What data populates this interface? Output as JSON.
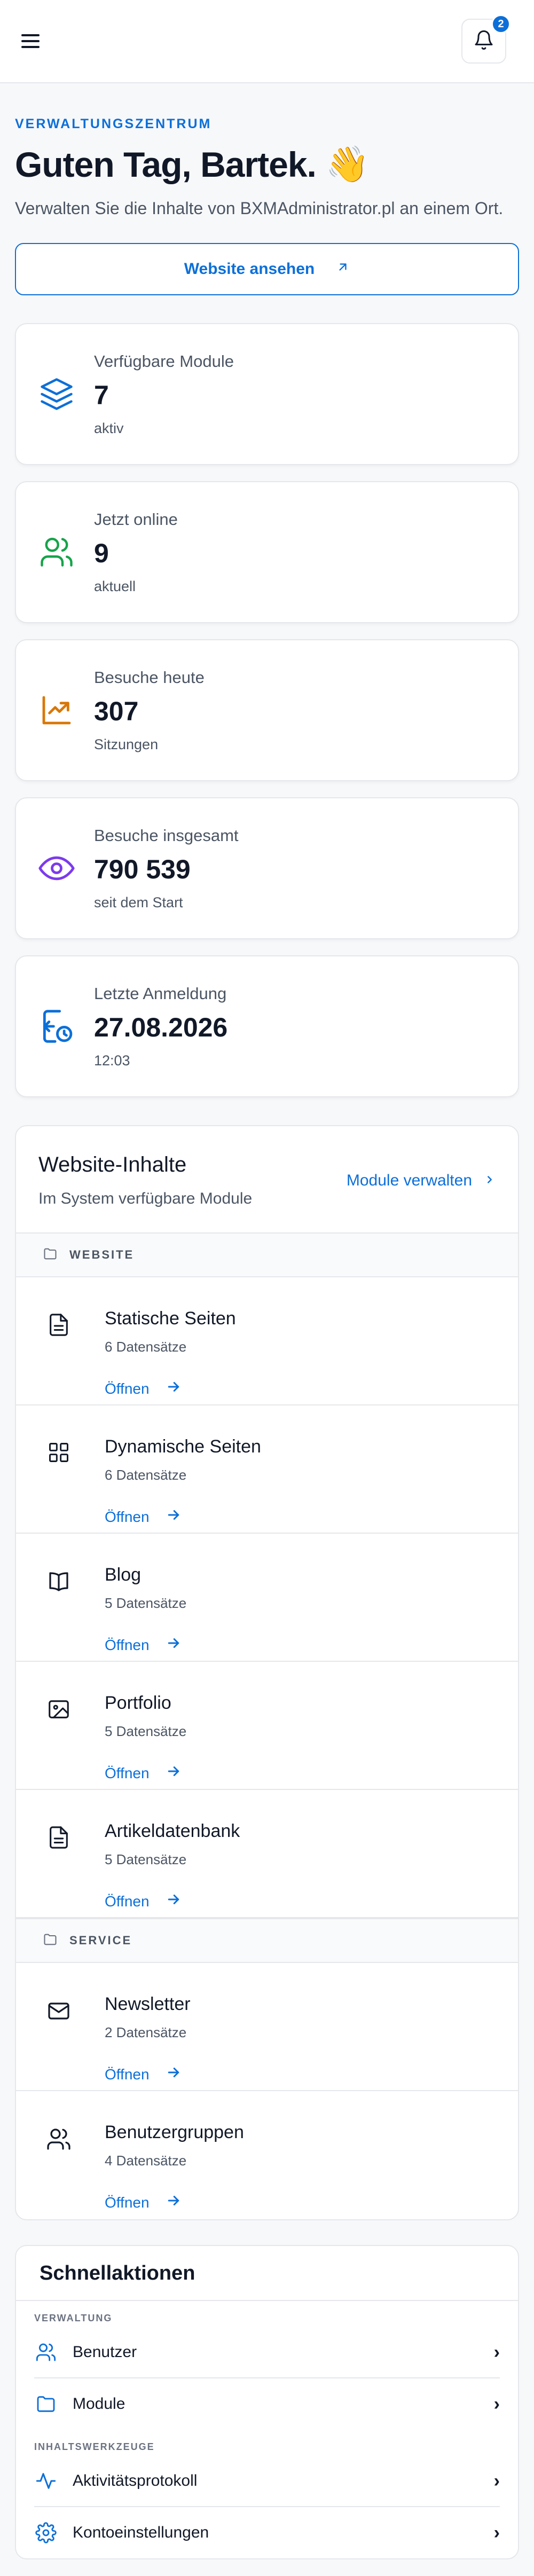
{
  "header": {
    "notifications_count": "2"
  },
  "hero": {
    "eyebrow": "VERWALTUNGSZENTRUM",
    "greeting": "Guten Tag, Bartek.",
    "greeting_emoji": "👋",
    "subtitle": "Verwalten Sie die Inhalte von BXMAdministrator.pl an einem Ort.",
    "view_site_label": "Website ansehen"
  },
  "stats": [
    {
      "label": "Verfügbare Module",
      "value": "7",
      "note": "aktiv",
      "icon": "layers-icon",
      "color": "#0c6fd8"
    },
    {
      "label": "Jetzt online",
      "value": "9",
      "note": "aktuell",
      "icon": "users-icon",
      "color": "#16a34a"
    },
    {
      "label": "Besuche heute",
      "value": "307",
      "note": "Sitzungen",
      "icon": "trending-up-icon",
      "color": "#d97706"
    },
    {
      "label": "Besuche insgesamt",
      "value": "790 539",
      "note": "seit dem Start",
      "icon": "eye-icon",
      "color": "#7c3aed"
    },
    {
      "label": "Letzte Anmeldung",
      "value": "27.08.2026",
      "note": "12:03",
      "icon": "login-clock-icon",
      "color": "#0c6fd8"
    }
  ],
  "content_panel": {
    "title": "Website-Inhalte",
    "subtitle": "Im System verfügbare Module",
    "manage_label": "Module verwalten",
    "groups": [
      {
        "name": "WEBSITE",
        "items": [
          {
            "name": "Statische Seiten",
            "count": "6 Datensätze",
            "open": "Öffnen",
            "icon": "document-icon"
          },
          {
            "name": "Dynamische Seiten",
            "count": "6 Datensätze",
            "open": "Öffnen",
            "icon": "grid-icon"
          },
          {
            "name": "Blog",
            "count": "5 Datensätze",
            "open": "Öffnen",
            "icon": "book-icon"
          },
          {
            "name": "Portfolio",
            "count": "5 Datensätze",
            "open": "Öffnen",
            "icon": "image-icon"
          },
          {
            "name": "Artikeldatenbank",
            "count": "5 Datensätze",
            "open": "Öffnen",
            "icon": "document-icon"
          }
        ]
      },
      {
        "name": "SERVICE",
        "items": [
          {
            "name": "Newsletter",
            "count": "2 Datensätze",
            "open": "Öffnen",
            "icon": "mail-icon"
          },
          {
            "name": "Benutzergruppen",
            "count": "4 Datensätze",
            "open": "Öffnen",
            "icon": "users-icon"
          }
        ]
      }
    ]
  },
  "quick_actions": {
    "title": "Schnellaktionen",
    "sections": [
      {
        "name": "VERWALTUNG",
        "items": [
          {
            "label": "Benutzer",
            "icon": "users-icon"
          },
          {
            "label": "Module",
            "icon": "folder-icon"
          }
        ]
      },
      {
        "name": "INHALTSWERKZEUGE",
        "items": [
          {
            "label": "Aktivitätsprotokoll",
            "icon": "activity-icon"
          },
          {
            "label": "Kontoeinstellungen",
            "icon": "gear-icon"
          }
        ]
      }
    ]
  },
  "colors": {
    "accent": "#0c6fd8",
    "text": "#111827",
    "muted": "#4b5563",
    "border": "#e5e7eb"
  }
}
